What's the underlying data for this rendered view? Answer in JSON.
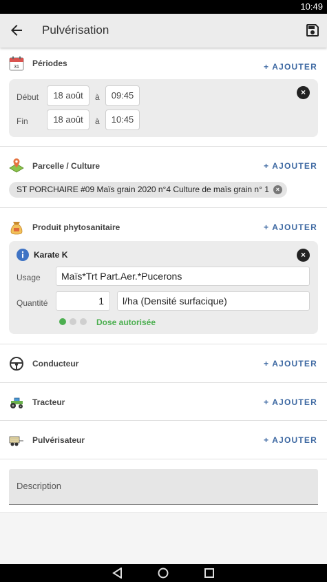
{
  "status": {
    "time": "10:49"
  },
  "appbar": {
    "title": "Pulvérisation",
    "back_icon": "arrow-left-icon",
    "save_icon": "floppy-disk-icon"
  },
  "add_label": "+ AJOUTER",
  "periods": {
    "title": "Périodes",
    "icon": "calendar-icon",
    "calendar_day": "31",
    "debut_label": "Début",
    "fin_label": "Fin",
    "a_label": "à",
    "debut_date": "18 août",
    "debut_time": "09:45",
    "fin_date": "18 août",
    "fin_time": "10:45"
  },
  "parcelle": {
    "title": "Parcelle / Culture",
    "icon": "map-pin-icon",
    "chip": "ST PORCHAIRE #09 Maïs grain 2020 n°4 Culture de maïs grain n° 1"
  },
  "produit": {
    "title": "Produit phytosanitaire",
    "icon": "sack-icon",
    "name": "Karate K",
    "info_icon": "info-icon",
    "usage_label": "Usage",
    "usage_value": "Maïs*Trt Part.Aer.*Pucerons",
    "quantite_label": "Quantité",
    "quantite_value": "1",
    "unit_value": "l/ha (Densité surfacique)",
    "dose_status": "Dose autorisée",
    "dose_level": 1,
    "dose_levels": 3,
    "ok_color": "#4caf50"
  },
  "conducteur": {
    "title": "Conducteur",
    "icon": "steering-wheel-icon"
  },
  "tracteur": {
    "title": "Tracteur",
    "icon": "tractor-icon"
  },
  "pulverisateur": {
    "title": "Pulvérisateur",
    "icon": "sprayer-icon"
  },
  "description": {
    "placeholder": "Description"
  },
  "colors": {
    "accent": "#3f6aa3",
    "appbar": "#ececec"
  }
}
